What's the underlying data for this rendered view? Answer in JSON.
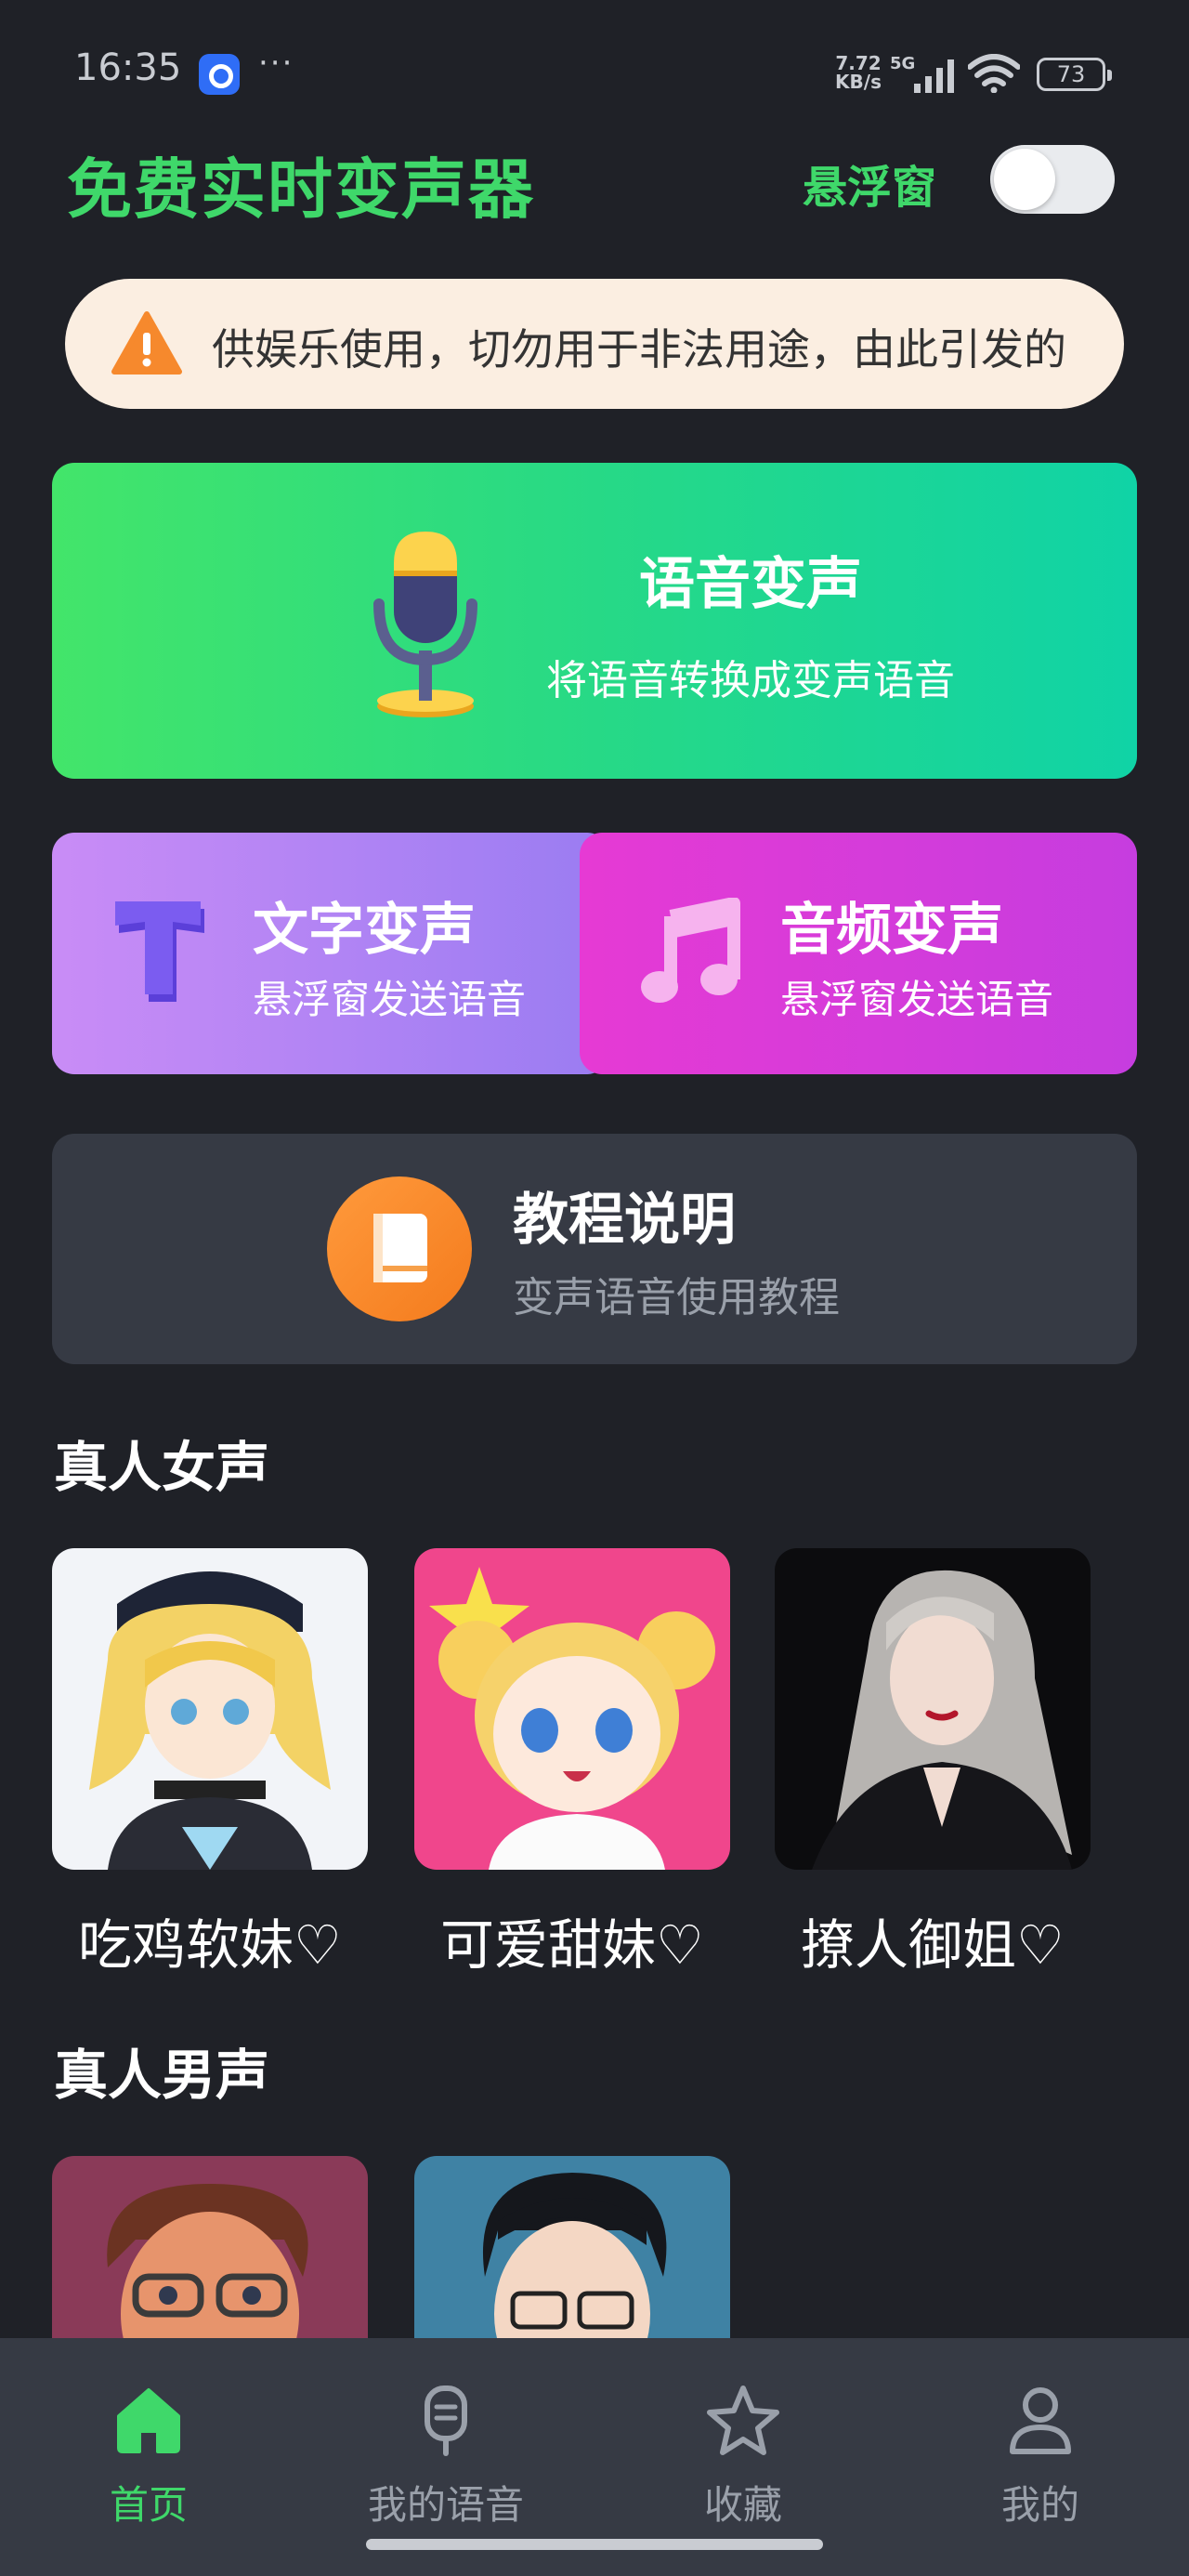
{
  "status_bar": {
    "time": "16:35",
    "more": "···",
    "speed_value": "7.72",
    "speed_unit": "KB/s",
    "network": "5G",
    "battery": "73"
  },
  "header": {
    "title": "免费实时变声器",
    "float_window_label": "悬浮窗",
    "float_window_enabled": false
  },
  "notice": {
    "text": "供娱乐使用，切勿用于非法用途，由此引发的"
  },
  "features": {
    "voice": {
      "title": "语音变声",
      "subtitle": "将语音转换成变声语音"
    },
    "text": {
      "title": "文字变声",
      "subtitle": "悬浮窗发送语音"
    },
    "audio": {
      "title": "音频变声",
      "subtitle": "悬浮窗发送语音"
    },
    "tutorial": {
      "title": "教程说明",
      "subtitle": "变声语音使用教程"
    }
  },
  "female_section": {
    "title": "真人女声",
    "items": [
      {
        "name": "吃鸡软妹♡"
      },
      {
        "name": "可爱甜妹♡"
      },
      {
        "name": "撩人御姐♡"
      }
    ]
  },
  "male_section": {
    "title": "真人男声"
  },
  "bottom_nav": [
    {
      "label": "首页",
      "icon": "home-icon",
      "active": true
    },
    {
      "label": "我的语音",
      "icon": "microphone-icon",
      "active": false
    },
    {
      "label": "收藏",
      "icon": "star-icon",
      "active": false
    },
    {
      "label": "我的",
      "icon": "user-icon",
      "active": false
    }
  ],
  "colors": {
    "background": "#1f2127",
    "accent": "#3fd86a",
    "card_dark": "#363a44",
    "notice_bg": "#fbeee1"
  }
}
